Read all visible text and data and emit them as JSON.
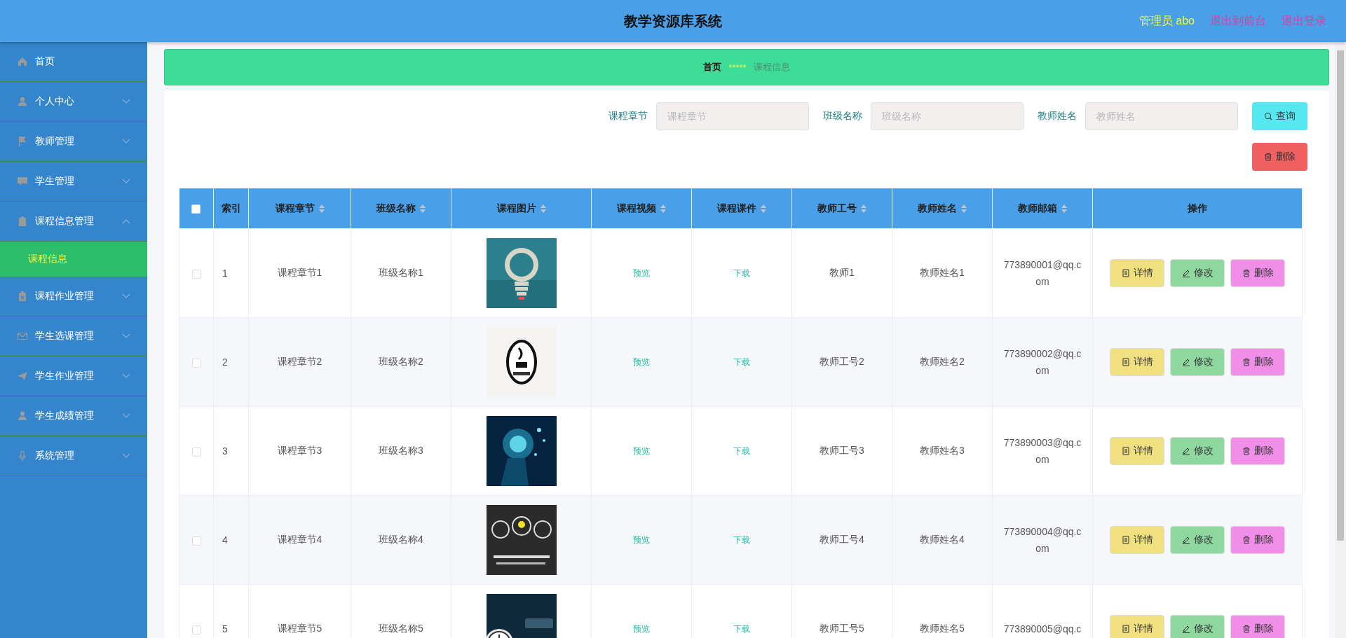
{
  "header": {
    "title": "教学资源库系统",
    "user": "管理员 abo",
    "links": [
      "退出到前台",
      "退出登录"
    ]
  },
  "sidebar": {
    "items": [
      {
        "label": "首页",
        "kind": "link"
      },
      {
        "label": "个人中心",
        "kind": "menu",
        "expanded": false
      },
      {
        "label": "教师管理",
        "kind": "menu",
        "expanded": false
      },
      {
        "label": "学生管理",
        "kind": "menu",
        "expanded": false
      },
      {
        "label": "课程信息管理",
        "kind": "menu",
        "expanded": true,
        "children": [
          {
            "label": "课程信息",
            "selected": true
          }
        ]
      },
      {
        "label": "课程作业管理",
        "kind": "menu",
        "expanded": false
      },
      {
        "label": "学生选课管理",
        "kind": "menu",
        "expanded": false
      },
      {
        "label": "学生作业管理",
        "kind": "menu",
        "expanded": false
      },
      {
        "label": "学生成绩管理",
        "kind": "menu",
        "expanded": false
      },
      {
        "label": "系统管理",
        "kind": "menu",
        "expanded": false
      }
    ]
  },
  "breadcrumb": {
    "home": "首页",
    "separator": "*****",
    "current": "课程信息"
  },
  "search": {
    "fields": [
      {
        "label": "课程章节",
        "placeholder": "课程章节"
      },
      {
        "label": "班级名称",
        "placeholder": "班级名称"
      },
      {
        "label": "教师姓名",
        "placeholder": "教师姓名"
      }
    ],
    "button": "查询",
    "delete_button": "删除"
  },
  "table": {
    "select_all": false,
    "columns": [
      {
        "label": "索引",
        "sortable": false
      },
      {
        "label": "课程章节",
        "sortable": true
      },
      {
        "label": "班级名称",
        "sortable": true
      },
      {
        "label": "课程图片",
        "sortable": true
      },
      {
        "label": "课程视频",
        "sortable": true
      },
      {
        "label": "课程课件",
        "sortable": true
      },
      {
        "label": "教师工号",
        "sortable": true
      },
      {
        "label": "教师姓名",
        "sortable": true
      },
      {
        "label": "教师邮箱",
        "sortable": true
      },
      {
        "label": "操作",
        "sortable": false
      }
    ],
    "rows": [
      {
        "checked": false,
        "index": "1",
        "chapter": "课程章节1",
        "class_name": "班级名称1",
        "video": "预览",
        "courseware": "下载",
        "teacher_id": "教师1",
        "teacher_name": "教师姓名1",
        "email": "773890001@qq.com",
        "actions": [
          "详情",
          "修改",
          "删除"
        ]
      },
      {
        "checked": false,
        "index": "2",
        "chapter": "课程章节2",
        "class_name": "班级名称2",
        "video": "预览",
        "courseware": "下载",
        "teacher_id": "教师工号2",
        "teacher_name": "教师姓名2",
        "email": "773890002@qq.com",
        "actions": [
          "详情",
          "修改",
          "删除"
        ]
      },
      {
        "checked": false,
        "index": "3",
        "chapter": "课程章节3",
        "class_name": "班级名称3",
        "video": "预览",
        "courseware": "下载",
        "teacher_id": "教师工号3",
        "teacher_name": "教师姓名3",
        "email": "773890003@qq.com",
        "actions": [
          "详情",
          "修改",
          "删除"
        ]
      },
      {
        "checked": false,
        "index": "4",
        "chapter": "课程章节4",
        "class_name": "班级名称4",
        "video": "预览",
        "courseware": "下载",
        "teacher_id": "教师工号4",
        "teacher_name": "教师姓名4",
        "email": "773890004@qq.com",
        "actions": [
          "详情",
          "修改",
          "删除"
        ]
      },
      {
        "checked": false,
        "index": "5",
        "chapter": "课程章节5",
        "class_name": "班级名称5",
        "video": "预览",
        "courseware": "下载",
        "teacher_id": "教师工号5",
        "teacher_name": "教师姓名5",
        "email": "773890005@qq.c",
        "actions": [
          "详情",
          "修改",
          "删除"
        ]
      }
    ]
  }
}
